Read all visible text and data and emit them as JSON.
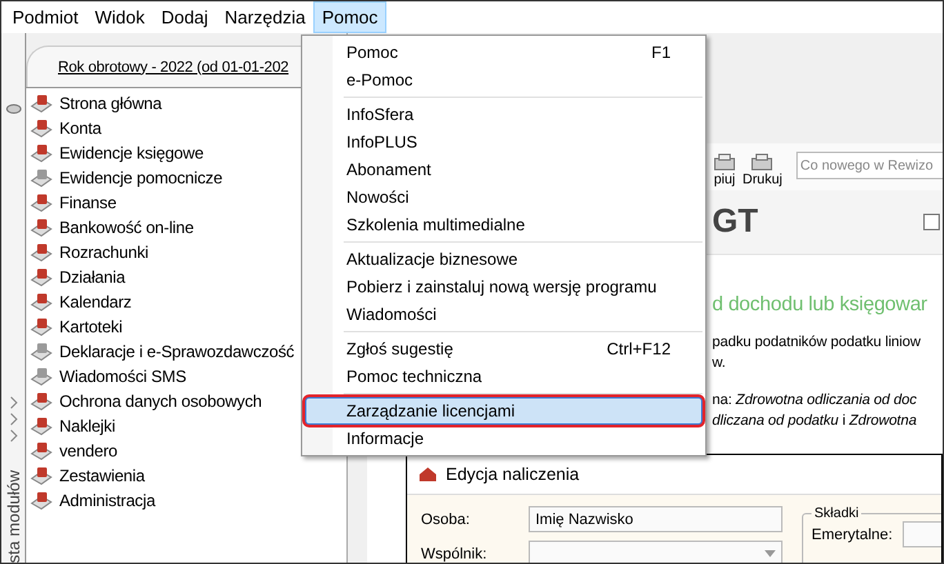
{
  "menubar": [
    {
      "label": "Podmiot",
      "selected": false
    },
    {
      "label": "Widok",
      "selected": false
    },
    {
      "label": "Dodaj",
      "selected": false
    },
    {
      "label": "Narzędzia",
      "selected": false
    },
    {
      "label": "Pomoc",
      "selected": true
    }
  ],
  "dropdown": {
    "groups": [
      [
        {
          "label": "Pomoc",
          "shortcut": "F1",
          "selected": false
        },
        {
          "label": "e-Pomoc",
          "selected": false
        }
      ],
      [
        {
          "label": "InfoSfera",
          "selected": false
        },
        {
          "label": "InfoPLUS",
          "selected": false
        },
        {
          "label": "Abonament",
          "selected": false
        },
        {
          "label": "Nowości",
          "selected": false
        },
        {
          "label": "Szkolenia multimedialne",
          "selected": false
        }
      ],
      [
        {
          "label": "Aktualizacje biznesowe",
          "selected": false
        },
        {
          "label": "Pobierz i zainstaluj nową wersję programu",
          "selected": false
        },
        {
          "label": "Wiadomości",
          "selected": false
        }
      ],
      [
        {
          "label": "Zgłoś sugestię",
          "shortcut": "Ctrl+F12",
          "selected": false
        },
        {
          "label": "Pomoc techniczna",
          "selected": false
        }
      ],
      [
        {
          "label": "Zarządzanie licencjami",
          "selected": true
        },
        {
          "label": "Informacje",
          "selected": false
        }
      ]
    ]
  },
  "sidebar": {
    "vertical_label": "sta modułów",
    "header": "Rok obrotowy - 2022  (od 01-01-202",
    "items": [
      {
        "label": "Strona główna",
        "color": "#c0392b"
      },
      {
        "label": "Konta",
        "color": "#c0392b"
      },
      {
        "label": "Ewidencje księgowe",
        "color": "#c0392b"
      },
      {
        "label": "Ewidencje pomocnicze",
        "color": "#9a9a9a"
      },
      {
        "label": "Finanse",
        "color": "#c0392b"
      },
      {
        "label": "Bankowość on-line",
        "color": "#c0392b"
      },
      {
        "label": "Rozrachunki",
        "color": "#c0392b"
      },
      {
        "label": "Działania",
        "color": "#c0392b"
      },
      {
        "label": "Kalendarz",
        "color": "#c0392b"
      },
      {
        "label": "Kartoteki",
        "color": "#c0392b"
      },
      {
        "label": "Deklaracje i e-Sprawozdawczość",
        "color": "#9a9a9a"
      },
      {
        "label": "Wiadomości SMS",
        "color": "#9a9a9a"
      },
      {
        "label": "Ochrona danych osobowych",
        "color": "#c0392b"
      },
      {
        "label": "Naklejki",
        "color": "#c0392b"
      },
      {
        "label": "vendero",
        "color": "#c0392b"
      },
      {
        "label": "Zestawienia",
        "color": "#c0392b"
      },
      {
        "label": "Administracja",
        "color": "#c0392b"
      }
    ]
  },
  "toolbar": {
    "buttons": [
      "piuj",
      "Drukuj"
    ],
    "search": {
      "placeholder": "Co nowego w Rewizo"
    }
  },
  "content": {
    "title": "GT",
    "checked": false,
    "heading": "d dochodu lub księgowar",
    "paragraphs": [
      [
        "padku podatników podatku liniow",
        "w."
      ],
      [
        "na: *Zdrowotna odliczania od doc*",
        "*dliczana od podatku* i *Zdrowotna*"
      ]
    ]
  },
  "dialog": {
    "title": "Edycja naliczenia",
    "fields": [
      {
        "label": "Osoba:",
        "value": "Imię Nazwisko",
        "kind": "text"
      },
      {
        "label": "Wspólnik:",
        "kind": "select"
      }
    ],
    "group": {
      "title": "Składki",
      "fields": [
        {
          "label": "Emerytalne:"
        }
      ]
    }
  }
}
